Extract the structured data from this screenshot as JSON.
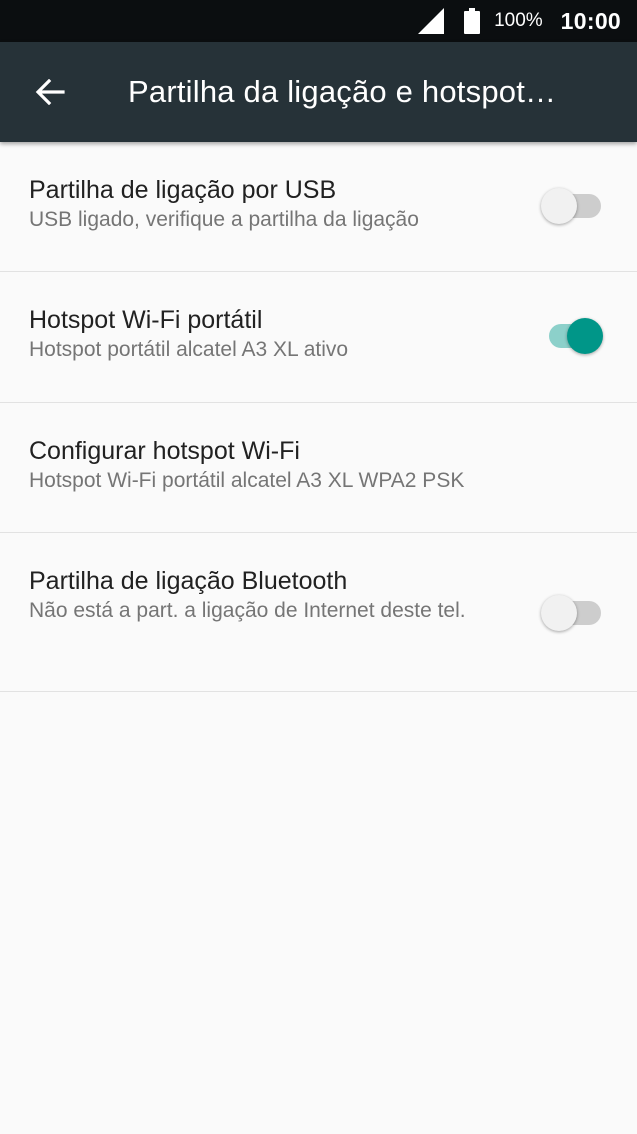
{
  "status_bar": {
    "battery_percent": "100%",
    "time": "10:00",
    "icons": [
      "cell-signal-icon",
      "battery-icon"
    ]
  },
  "app_bar": {
    "title": "Partilha da ligação e hotspot…",
    "back_icon": "back-arrow-icon"
  },
  "settings": [
    {
      "title": "Partilha de ligação por USB",
      "summary": "USB ligado, verifique a partilha da ligação",
      "toggle": "off"
    },
    {
      "title": "Hotspot Wi-Fi portátil",
      "summary": "Hotspot portátil alcatel A3 XL ativo",
      "toggle": "on"
    },
    {
      "title": "Configurar hotspot Wi-Fi",
      "summary": "Hotspot Wi-Fi portátil alcatel A3 XL WPA2 PSK"
    },
    {
      "title": "Partilha de ligação Bluetooth",
      "summary": "Não está a part. a ligação de Internet deste tel.",
      "toggle": "off"
    }
  ],
  "colors": {
    "status_bar": "#0b0e10",
    "app_bar": "#263238",
    "accent": "#009688",
    "background": "#fafafa"
  }
}
